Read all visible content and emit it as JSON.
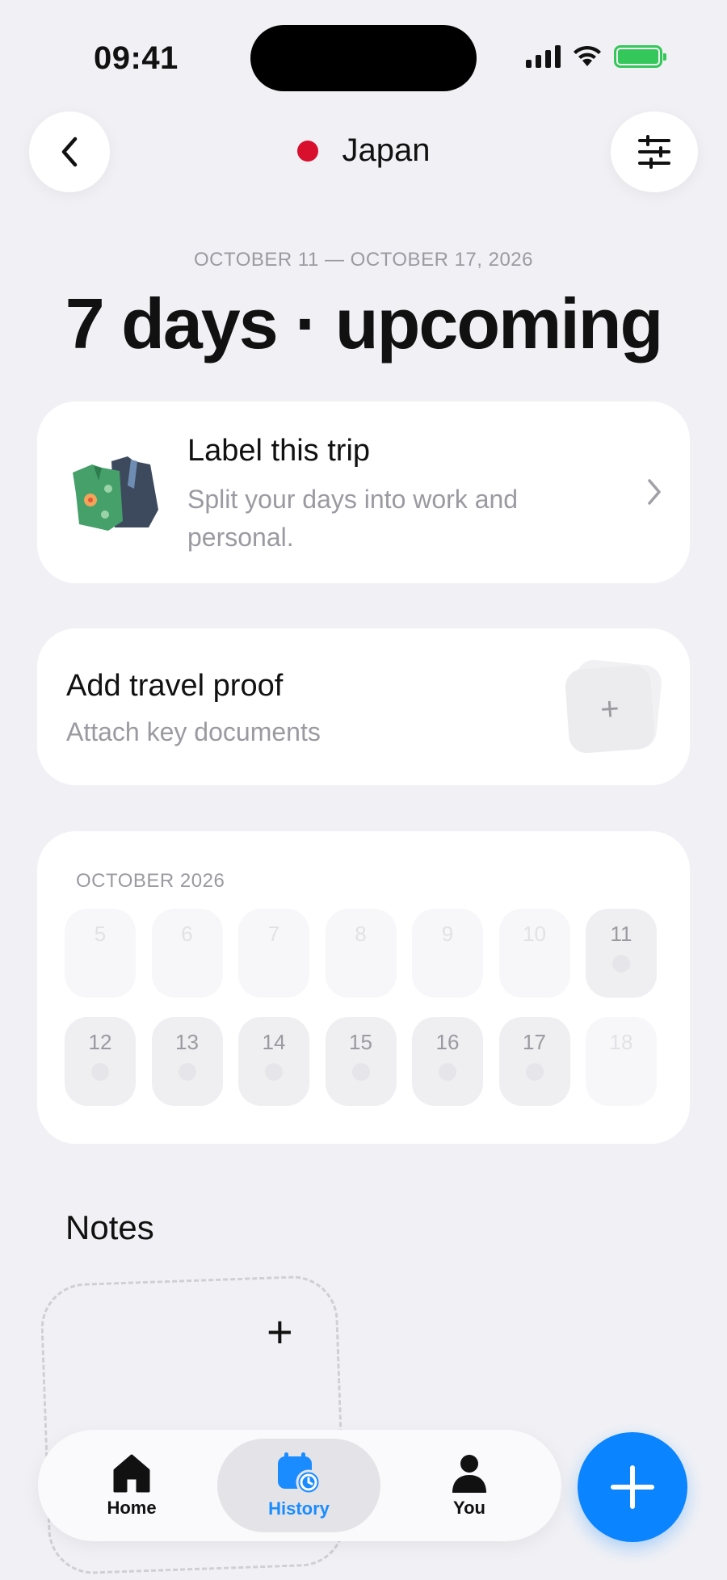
{
  "status_bar": {
    "time": "09:41"
  },
  "header": {
    "country": "Japan",
    "flag_color": "#d8102e"
  },
  "trip": {
    "date_range": "OCTOBER 11 — OCTOBER 17, 2026",
    "headline": "7 days · upcoming"
  },
  "label_card": {
    "title": "Label this trip",
    "subtitle": "Split your days into work and personal."
  },
  "proof_card": {
    "title": "Add travel proof",
    "subtitle": "Attach key documents",
    "add_symbol": "+"
  },
  "calendar": {
    "month": "OCTOBER 2026",
    "days": [
      {
        "num": "5",
        "in_trip": false
      },
      {
        "num": "6",
        "in_trip": false
      },
      {
        "num": "7",
        "in_trip": false
      },
      {
        "num": "8",
        "in_trip": false
      },
      {
        "num": "9",
        "in_trip": false
      },
      {
        "num": "10",
        "in_trip": false
      },
      {
        "num": "11",
        "in_trip": true
      },
      {
        "num": "12",
        "in_trip": true
      },
      {
        "num": "13",
        "in_trip": true
      },
      {
        "num": "14",
        "in_trip": true
      },
      {
        "num": "15",
        "in_trip": true
      },
      {
        "num": "16",
        "in_trip": true
      },
      {
        "num": "17",
        "in_trip": true
      },
      {
        "num": "18",
        "in_trip": false
      }
    ]
  },
  "notes": {
    "title": "Notes",
    "add_symbol": "+"
  },
  "tabbar": {
    "active": "History",
    "active_color": "#1a8cff",
    "tabs": [
      {
        "label": "Home",
        "icon": "home-icon"
      },
      {
        "label": "History",
        "icon": "calendar-clock-icon"
      },
      {
        "label": "You",
        "icon": "person-icon"
      }
    ]
  },
  "fab": {
    "icon": "plus-icon",
    "color": "#0a84ff"
  }
}
